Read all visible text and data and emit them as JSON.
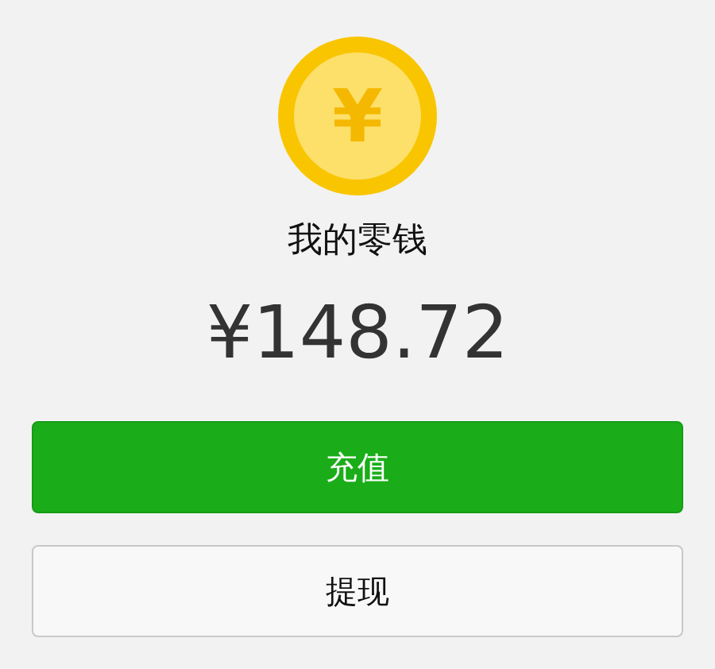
{
  "wallet": {
    "coin_symbol": "¥",
    "title": "我的零钱",
    "balance": "¥148.72"
  },
  "buttons": [
    {
      "label": "充值",
      "kind": "primary"
    },
    {
      "label": "提现",
      "kind": "default"
    }
  ]
}
